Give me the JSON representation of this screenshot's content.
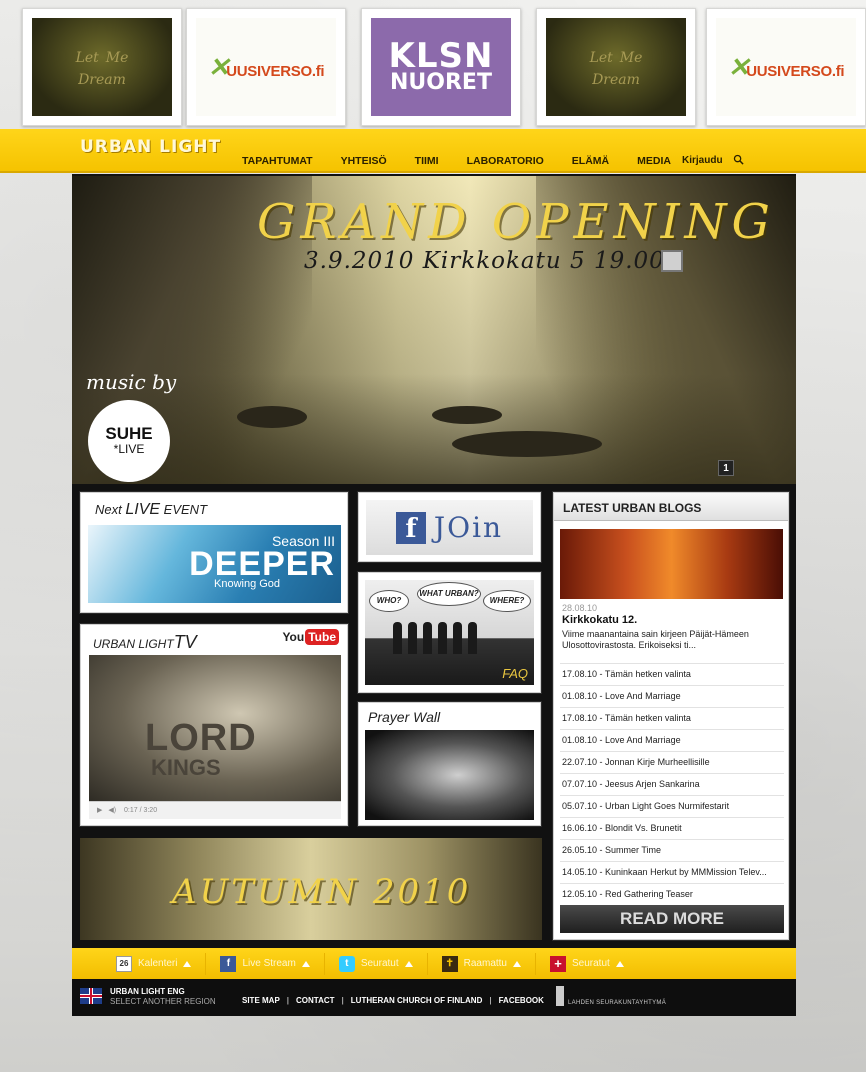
{
  "ads": [
    {
      "type": "dream",
      "line1": "Let",
      "line2": "Me",
      "line3": "Dream"
    },
    {
      "type": "uusi",
      "text": "UUSIVERSO.fi"
    },
    {
      "type": "klsn",
      "line1": "KLSN",
      "line2": "NUORET"
    },
    {
      "type": "dream",
      "line1": "Let",
      "line2": "Me",
      "line3": "Dream"
    },
    {
      "type": "uusi",
      "text": "UUSIVERSO.fi"
    }
  ],
  "header": {
    "logo": "URBAN LIGHT",
    "nav": [
      "TAPAHTUMAT",
      "YHTEISÖ",
      "TIIMI",
      "LABORATORIO",
      "ELÄMÄ",
      "MEDIA"
    ],
    "login": "Kirjaudu",
    "search_icon": "search-icon"
  },
  "hero": {
    "title": "GRAND OPENING",
    "subtitle": "3.9.2010  Kirkkokatu 5  19.00",
    "music_by": "music by",
    "badge_main": "SUHE",
    "badge_sub": "*LIVE",
    "slide_number": "1"
  },
  "next_event": {
    "prefix": "Next",
    "live": "LIVE",
    "suffix": "EVENT",
    "banner_season": "Season III",
    "banner_title": "DEEPER",
    "banner_sub": "Knowing God"
  },
  "tv": {
    "title": "URBAN LIGHT",
    "title_tv": "TV",
    "youtube_a": "You",
    "youtube_b": "Tube",
    "video_text1": "LORD",
    "video_text2": "KINGS",
    "time": "0:17 / 3:20"
  },
  "join": {
    "fb": "f",
    "text": "JOin"
  },
  "faq": {
    "bubble1": "WHO?",
    "bubble2": "WHAT URBAN?",
    "bubble3": "WHERE?",
    "label": "FAQ"
  },
  "prayer": {
    "title": "Prayer Wall"
  },
  "blogs": {
    "title": "LATEST URBAN BLOGS",
    "feature_date": "28.08.10",
    "feature_title": "Kirkkokatu 12.",
    "feature_excerpt": "Viime maanantaina sain kirjeen Päijät-Hämeen Ulosottovirastosta. Erikoiseksi ti...",
    "items": [
      "17.08.10 - Tämän hetken valinta",
      "01.08.10 - Love And Marriage",
      "17.08.10 - Tämän hetken valinta",
      "01.08.10 - Love And Marriage",
      "22.07.10 - Jonnan Kirje Murheellisille",
      "07.07.10 - Jeesus Arjen Sankarina",
      "05.07.10 - Urban Light Goes Nurmifestarit",
      "16.06.10 - Blondit Vs. Brunetit",
      "26.05.10 - Summer Time",
      "14.05.10 - Kuninkaan Herkut by MMMission Telev...",
      "12.05.10 - Red Gathering Teaser"
    ],
    "read_more": "READ MORE"
  },
  "autumn": {
    "text": "AUTUMN 2010"
  },
  "toolbar": [
    {
      "icon": "calendar-icon",
      "icon_text": "26",
      "label": "Kalenteri"
    },
    {
      "icon": "facebook-icon",
      "icon_text": "f",
      "label": "Live Stream"
    },
    {
      "icon": "twitter-icon",
      "icon_text": "t",
      "label": "Seuratut"
    },
    {
      "icon": "bible-icon",
      "icon_text": "✝",
      "label": "Raamattu"
    },
    {
      "icon": "cross-icon",
      "icon_text": "+",
      "label": "Seuratut"
    }
  ],
  "footer": {
    "region_title": "URBAN LIGHT ENG",
    "region_sub": "SELECT ANOTHER REGION",
    "links": [
      "SITE MAP",
      "CONTACT",
      "LUTHERAN CHURCH OF FINLAND",
      "FACEBOOK"
    ],
    "partner": "LAHDEN SEURAKUNTAYHTYMÄ"
  },
  "colors": {
    "accent_yellow": "#f5c300",
    "dark_panel": "#111111",
    "facebook_blue": "#3b5998"
  }
}
